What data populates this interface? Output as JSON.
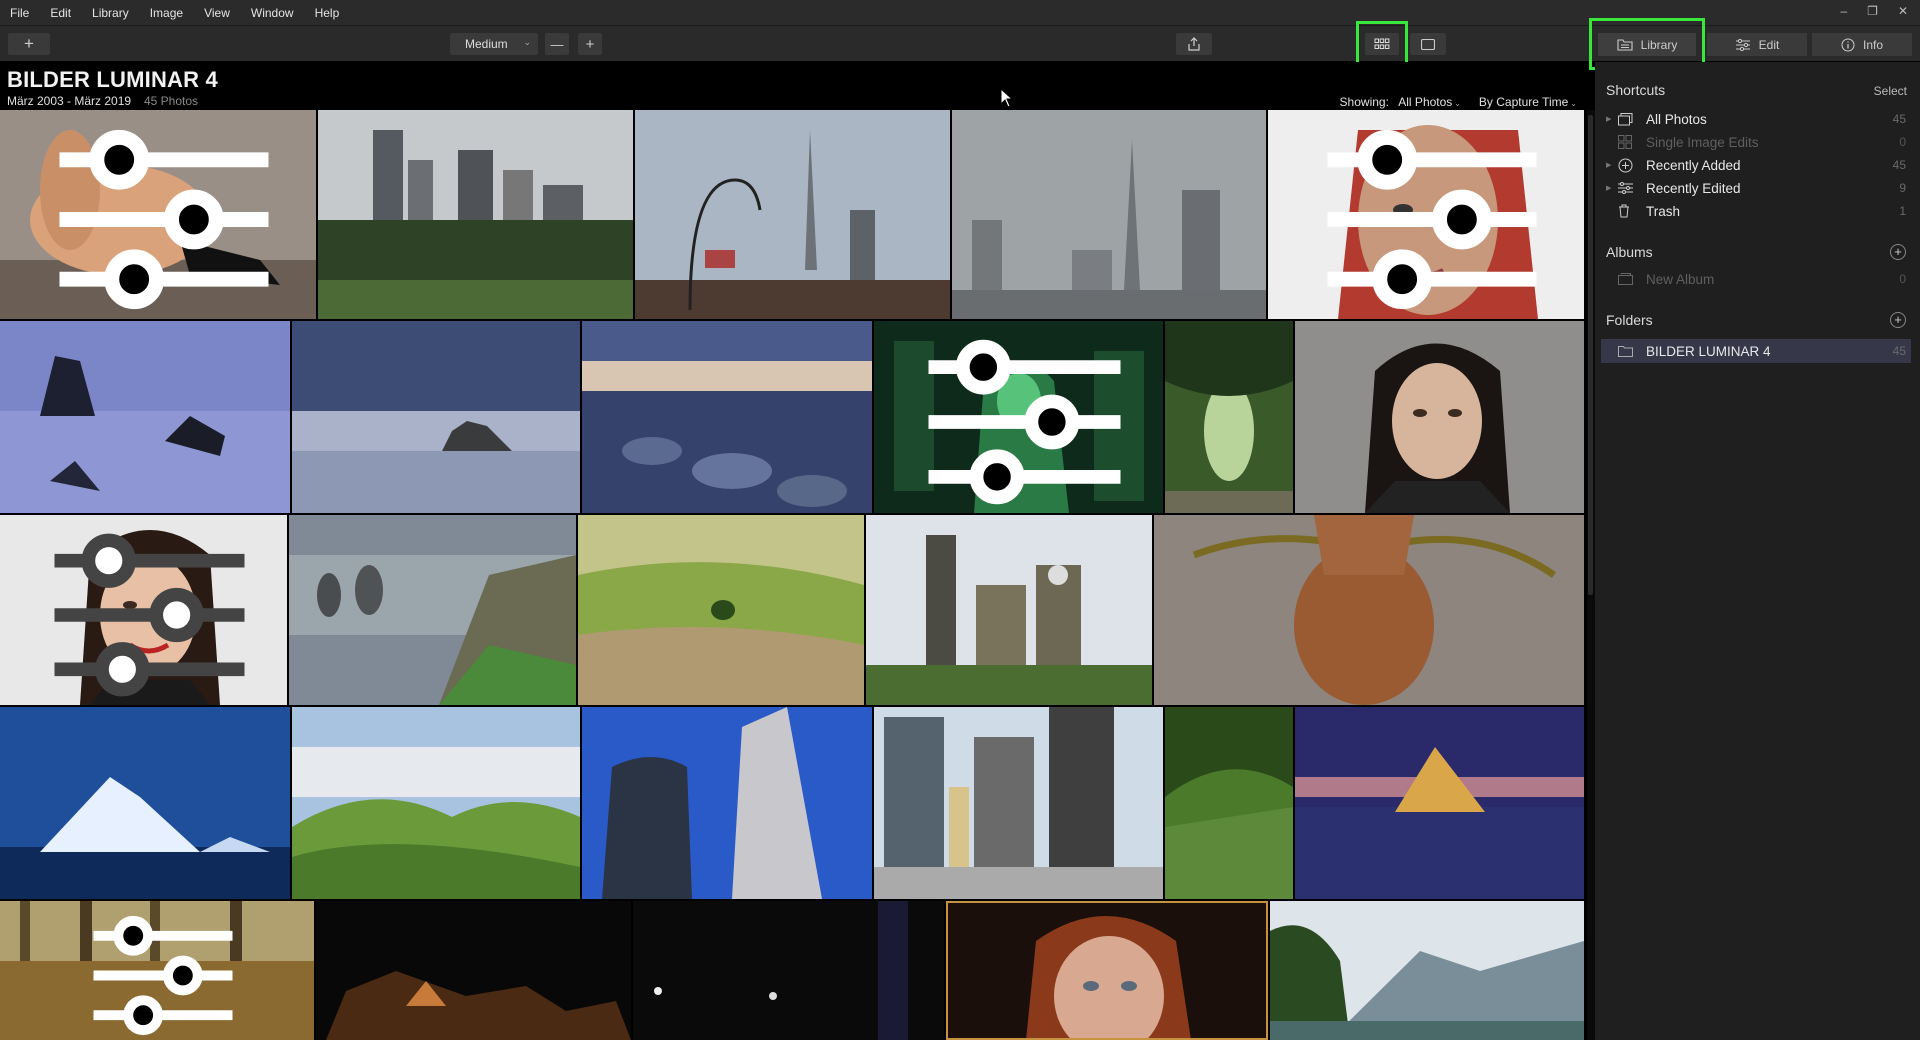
{
  "menu": [
    "File",
    "Edit",
    "Library",
    "Image",
    "View",
    "Window",
    "Help"
  ],
  "window_controls": [
    "–",
    "❐",
    "✕"
  ],
  "toolbar": {
    "size_value": "Medium",
    "minus": "—",
    "plus": "+",
    "add": "+"
  },
  "tabs": {
    "library": "Library",
    "edit": "Edit",
    "info": "Info"
  },
  "header": {
    "title": "BILDER LUMINAR 4",
    "date_range": "März 2003 - März 2019",
    "photo_count": "45 Photos",
    "showing_label": "Showing:",
    "showing_value": "All Photos",
    "sort_value": "By Capture Time"
  },
  "sidebar": {
    "shortcuts_title": "Shortcuts",
    "select_label": "Select",
    "shortcuts": [
      {
        "label": "All Photos",
        "count": "45"
      },
      {
        "label": "Single Image Edits",
        "count": "0"
      },
      {
        "label": "Recently Added",
        "count": "45"
      },
      {
        "label": "Recently Edited",
        "count": "9"
      },
      {
        "label": "Trash",
        "count": "1"
      }
    ],
    "albums_title": "Albums",
    "albums_new": "New Album",
    "albums_count": "0",
    "folders_title": "Folders",
    "folder": {
      "label": "BILDER LUMINAR 4",
      "count": "45"
    }
  },
  "accent_highlight": "#39e63a"
}
